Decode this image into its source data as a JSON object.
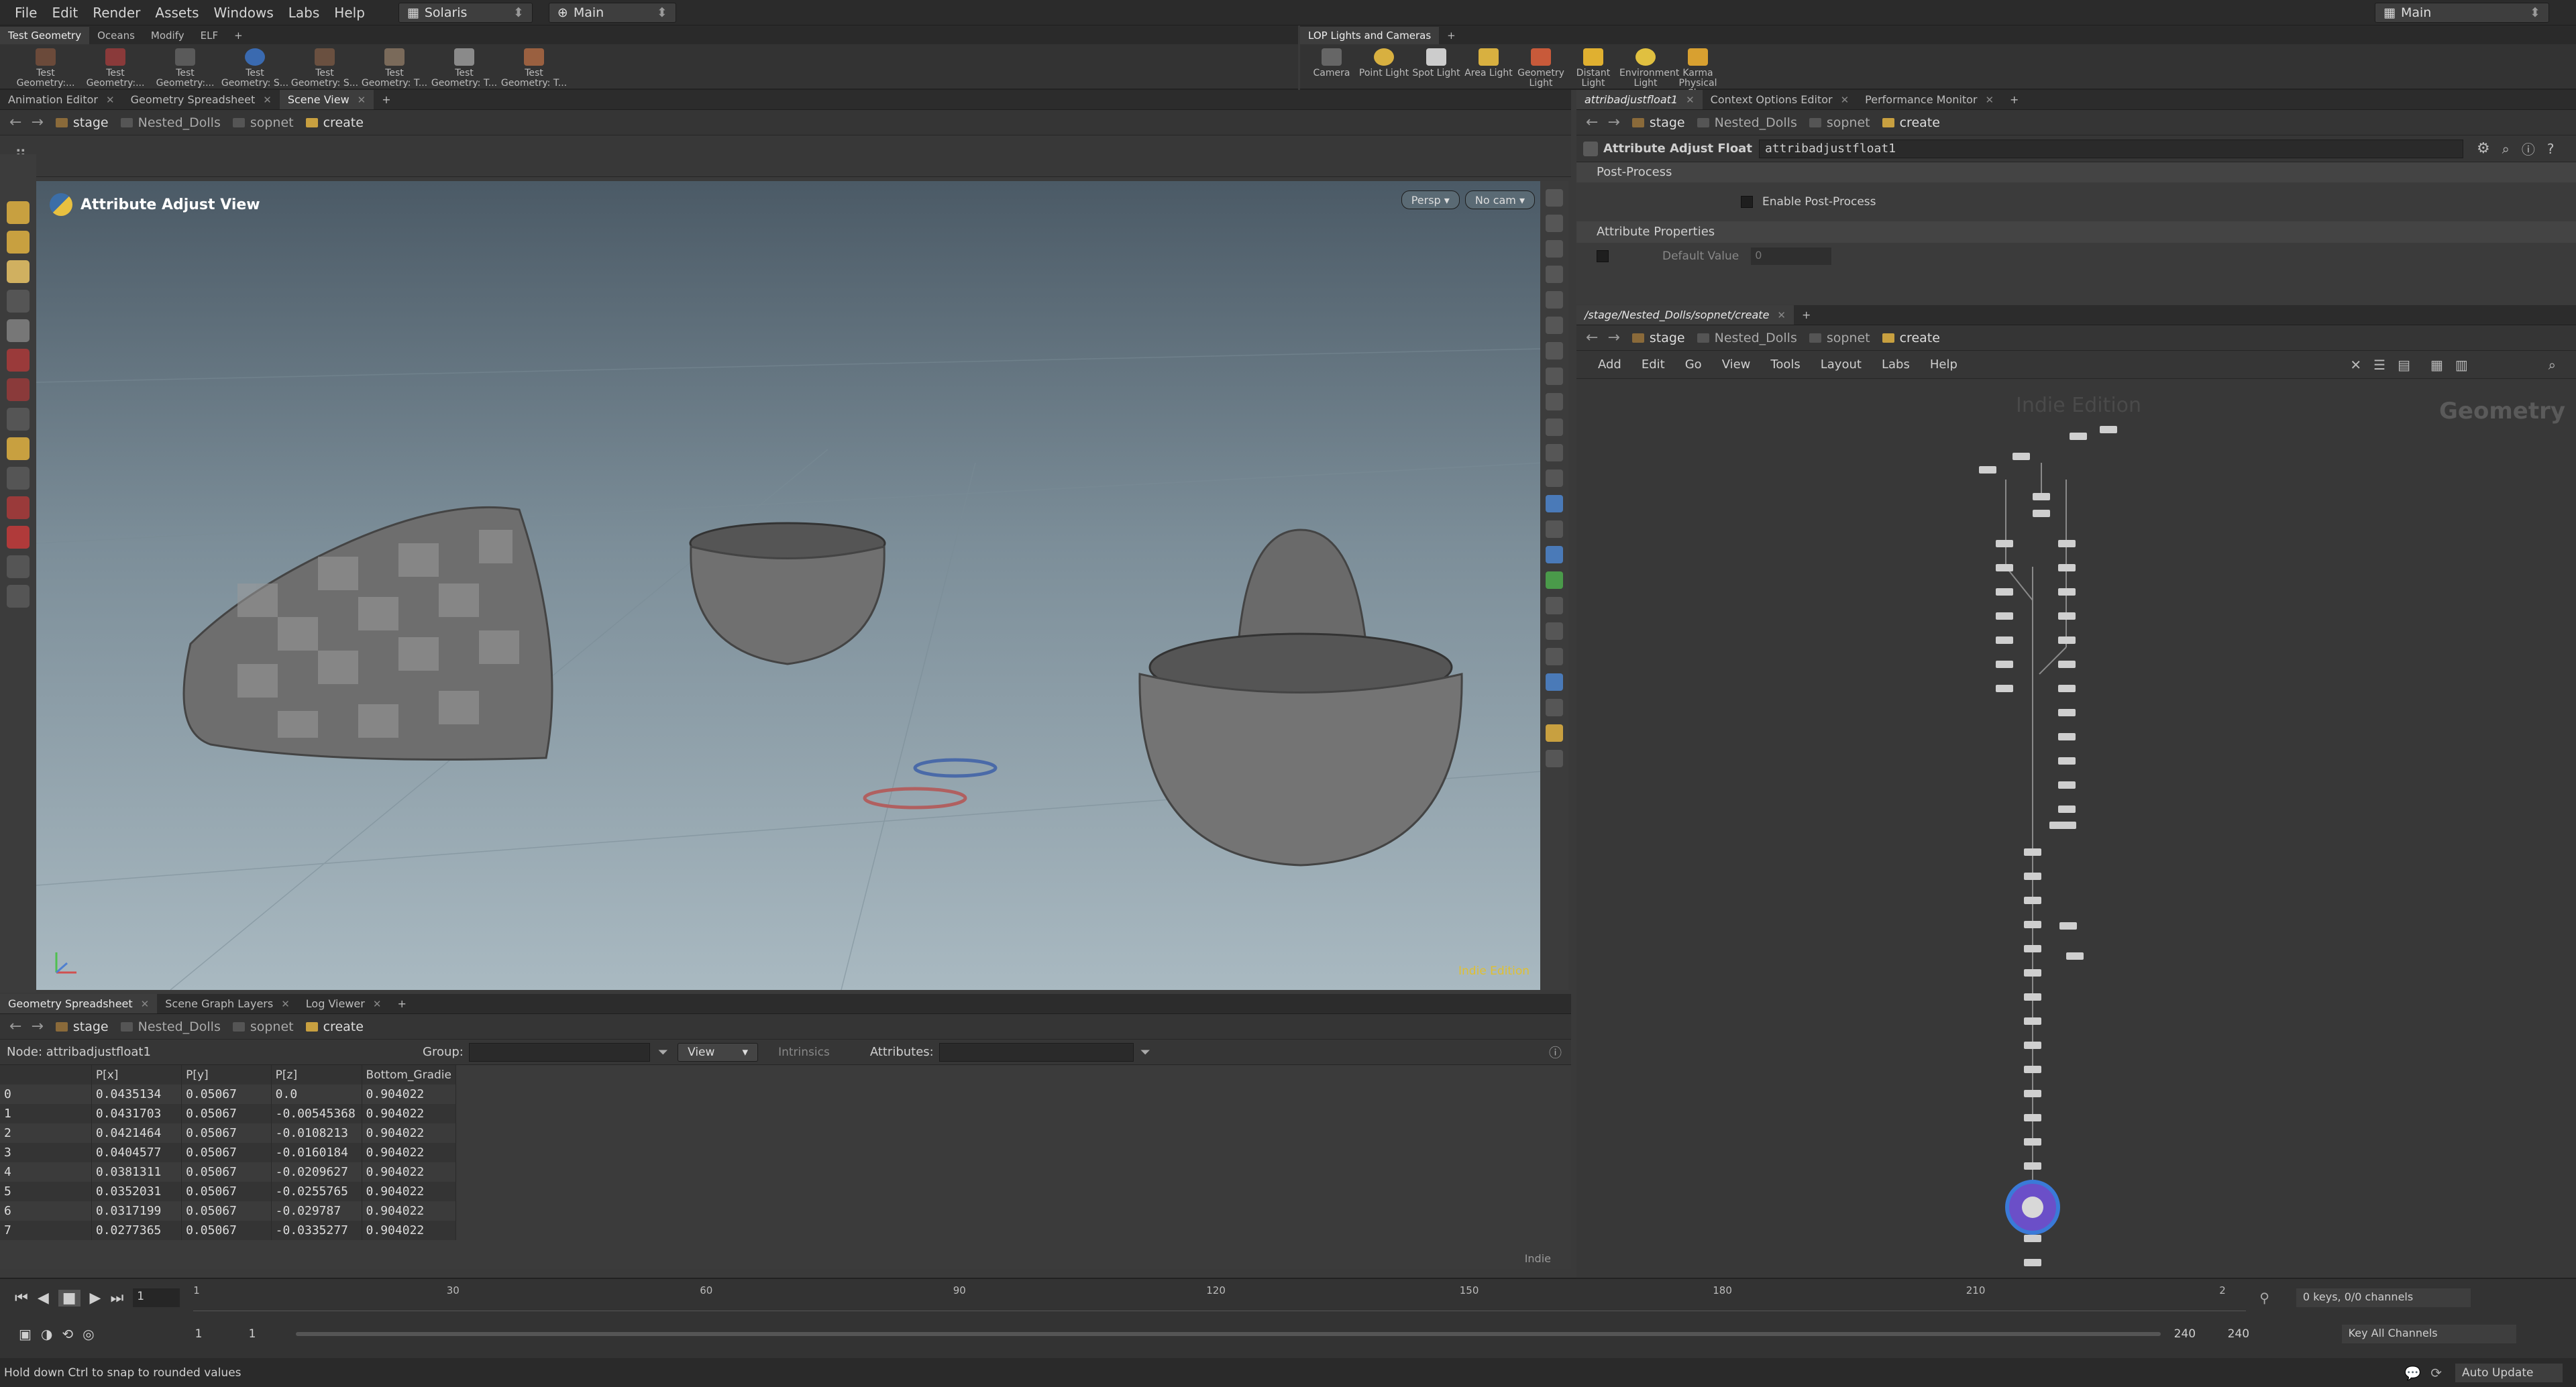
{
  "menubar": {
    "items": [
      "File",
      "Edit",
      "Render",
      "Assets",
      "Windows",
      "Labs",
      "Help"
    ],
    "desktop": "Solaris",
    "context": "Main",
    "right_desktop": "Main"
  },
  "shelf_left": {
    "tabs": [
      "Test Geometry",
      "Oceans",
      "Modify",
      "ELF"
    ],
    "tools": [
      "Test Geometry:...",
      "Test Geometry:...",
      "Test Geometry:...",
      "Test Geometry: S...",
      "Test Geometry: S...",
      "Test Geometry: T...",
      "Test Geometry: T...",
      "Test Geometry: T..."
    ]
  },
  "shelf_right": {
    "tabs": [
      "LOP Lights and Cameras"
    ],
    "tools": [
      "Camera",
      "Point Light",
      "Spot Light",
      "Area Light",
      "Geometry Light",
      "Distant Light",
      "Environment Light",
      "Karma Physical Sk..."
    ]
  },
  "scene_pane": {
    "tabs": [
      "Animation Editor",
      "Geometry Spreadsheet",
      "Scene View"
    ],
    "path": [
      "stage",
      "Nested_Dolls",
      "sopnet",
      "create"
    ],
    "viewport_title": "Attribute Adjust View",
    "persp": "Persp",
    "cam": "No cam",
    "watermark": "Indie Edition"
  },
  "spreadsheet": {
    "tabs": [
      "Geometry Spreadsheet",
      "Scene Graph Layers",
      "Log Viewer"
    ],
    "path": [
      "stage",
      "Nested_Dolls",
      "sopnet",
      "create"
    ],
    "node_label": "Node: attribadjustfloat1",
    "group_label": "Group:",
    "view_label": "View",
    "intrinsics": "Intrinsics",
    "attributes_label": "Attributes:",
    "columns": [
      "",
      "P[x]",
      "P[y]",
      "P[z]",
      "Bottom_Gradie"
    ],
    "rows": [
      [
        "0",
        "0.0435134",
        "0.05067",
        "0.0",
        "0.904022"
      ],
      [
        "1",
        "0.0431703",
        "0.05067",
        "-0.00545368",
        "0.904022"
      ],
      [
        "2",
        "0.0421464",
        "0.05067",
        "-0.0108213",
        "0.904022"
      ],
      [
        "3",
        "0.0404577",
        "0.05067",
        "-0.0160184",
        "0.904022"
      ],
      [
        "4",
        "0.0381311",
        "0.05067",
        "-0.0209627",
        "0.904022"
      ],
      [
        "5",
        "0.0352031",
        "0.05067",
        "-0.0255765",
        "0.904022"
      ],
      [
        "6",
        "0.0317199",
        "0.05067",
        "-0.029787",
        "0.904022"
      ],
      [
        "7",
        "0.0277365",
        "0.05067",
        "-0.0335277",
        "0.904022"
      ]
    ],
    "indie": "Indie"
  },
  "param_pane": {
    "tabs": [
      "attribadjustfloat1",
      "Context Options Editor",
      "Performance Monitor"
    ],
    "path": [
      "stage",
      "Nested_Dolls",
      "sopnet",
      "create"
    ],
    "node_type": "Attribute Adjust Float",
    "node_name": "attribadjustfloat1",
    "section1": "Post-Process",
    "enable_post": "Enable Post-Process",
    "section2": "Attribute Properties",
    "default_value": "Default Value",
    "default_num": "0"
  },
  "net_pane": {
    "tabs": [
      "/stage/Nested_Dolls/sopnet/create"
    ],
    "path": [
      "stage",
      "Nested_Dolls",
      "sopnet",
      "create"
    ],
    "menu": [
      "Add",
      "Edit",
      "Go",
      "View",
      "Tools",
      "Layout",
      "Labs",
      "Help"
    ],
    "context_label": "Geometry",
    "indie_label": "Indie Edition"
  },
  "timeline": {
    "frame": "1",
    "ticks": [
      "1",
      "30",
      "60",
      "90",
      "120",
      "150",
      "180",
      "210",
      "2"
    ],
    "start": "1",
    "start2": "1",
    "end": "240",
    "end2": "240",
    "keys": "0 keys, 0/0 channels",
    "key_all": "Key All Channels"
  },
  "status": {
    "message": "Hold down Ctrl to snap to rounded values",
    "auto_update": "Auto Update"
  },
  "colors": {
    "accent": "#e8a64a",
    "node_sel": "#7b5bd6",
    "viewport_top": "#4b5a66",
    "viewport_bottom": "#a9b9c1"
  }
}
